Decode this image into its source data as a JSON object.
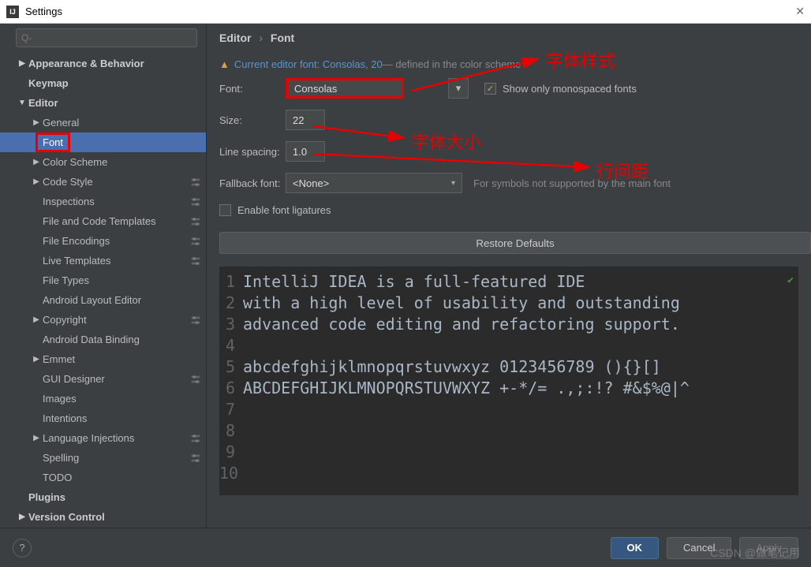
{
  "window": {
    "title": "Settings"
  },
  "search": {
    "placeholder": "Q-"
  },
  "breadcrumb": {
    "a": "Editor",
    "b": "Font"
  },
  "warning": {
    "link": "Current editor font: Consolas, 20",
    "rest": " — defined in the color scheme"
  },
  "form": {
    "font_label": "Font:",
    "font_value": "Consolas",
    "show_mono": "Show only monospaced fonts",
    "size_label": "Size:",
    "size_value": "22",
    "spacing_label": "Line spacing:",
    "spacing_value": "1.0",
    "fallback_label": "Fallback font:",
    "fallback_value": "<None>",
    "fallback_hint": "For symbols not supported by the main font",
    "ligatures": "Enable font ligatures",
    "restore": "Restore Defaults"
  },
  "sidebar": {
    "items": [
      {
        "label": "Appearance & Behavior",
        "bold": true,
        "arrow": "▶",
        "indent": 0
      },
      {
        "label": "Keymap",
        "bold": true,
        "arrow": "",
        "indent": 0
      },
      {
        "label": "Editor",
        "bold": true,
        "arrow": "▼",
        "indent": 0
      },
      {
        "label": "General",
        "arrow": "▶",
        "indent": 1
      },
      {
        "label": "Font",
        "arrow": "",
        "indent": 1,
        "selected": true,
        "framed": true
      },
      {
        "label": "Color Scheme",
        "arrow": "▶",
        "indent": 1
      },
      {
        "label": "Code Style",
        "arrow": "▶",
        "indent": 1,
        "cfg": true
      },
      {
        "label": "Inspections",
        "arrow": "",
        "indent": 1,
        "cfg": true
      },
      {
        "label": "File and Code Templates",
        "arrow": "",
        "indent": 1,
        "cfg": true
      },
      {
        "label": "File Encodings",
        "arrow": "",
        "indent": 1,
        "cfg": true
      },
      {
        "label": "Live Templates",
        "arrow": "",
        "indent": 1,
        "cfg": true
      },
      {
        "label": "File Types",
        "arrow": "",
        "indent": 1
      },
      {
        "label": "Android Layout Editor",
        "arrow": "",
        "indent": 1
      },
      {
        "label": "Copyright",
        "arrow": "▶",
        "indent": 1,
        "cfg": true
      },
      {
        "label": "Android Data Binding",
        "arrow": "",
        "indent": 1
      },
      {
        "label": "Emmet",
        "arrow": "▶",
        "indent": 1
      },
      {
        "label": "GUI Designer",
        "arrow": "",
        "indent": 1,
        "cfg": true
      },
      {
        "label": "Images",
        "arrow": "",
        "indent": 1
      },
      {
        "label": "Intentions",
        "arrow": "",
        "indent": 1
      },
      {
        "label": "Language Injections",
        "arrow": "▶",
        "indent": 1,
        "cfg": true
      },
      {
        "label": "Spelling",
        "arrow": "",
        "indent": 1,
        "cfg": true
      },
      {
        "label": "TODO",
        "arrow": "",
        "indent": 1
      },
      {
        "label": "Plugins",
        "bold": true,
        "arrow": "",
        "indent": 0
      },
      {
        "label": "Version Control",
        "bold": true,
        "arrow": "▶",
        "indent": 0
      }
    ]
  },
  "preview": {
    "lines": [
      "IntelliJ IDEA is a full-featured IDE",
      "with a high level of usability and outstanding",
      "advanced code editing and refactoring support.",
      "",
      "abcdefghijklmnopqrstuvwxyz 0123456789 (){}[]",
      "ABCDEFGHIJKLMNOPQRSTUVWXYZ +-*/= .,;:!? #&$%@|^",
      "",
      "",
      "",
      ""
    ]
  },
  "footer": {
    "ok": "OK",
    "cancel": "Cancel",
    "apply": "Apply"
  },
  "annotations": {
    "a1": "字体样式",
    "a2": "字体大小",
    "a3": "行间距"
  },
  "watermark": "CSDN @做笔记用"
}
